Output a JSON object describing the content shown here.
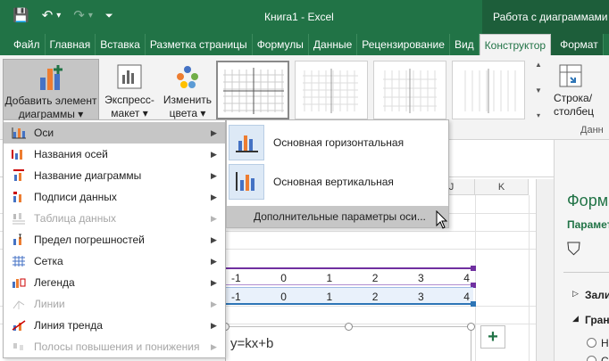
{
  "titlebar": {
    "save_icon": "💾",
    "undo_icon": "↶",
    "undo_caret": "▾",
    "redo_icon": "↷",
    "redo_caret": "▾",
    "qat_more": "⏷",
    "title": "Книга1 - Excel",
    "context": "Работа с диаграммами"
  },
  "tabs": [
    "Файл",
    "Главная",
    "Вставка",
    "Разметка страницы",
    "Формулы",
    "Данные",
    "Рецензирование",
    "Вид",
    "Конструктор",
    "Формат"
  ],
  "ribbon": {
    "add_element_line1": "Добавить элемент",
    "add_element_line2": "диаграммы ▾",
    "express_line1": "Экспресс-",
    "express_line2": "макет ▾",
    "color_line1": "Изменить",
    "color_line2": "цвета ▾",
    "switch_line1": "Строка/",
    "switch_line2": "столбец",
    "group_label": "Данн",
    "scroll_up": "▲",
    "scroll_down": "▼",
    "scroll_more": "▾"
  },
  "columns": [
    "J",
    "K"
  ],
  "rows": [
    [
      "-1",
      "0",
      "1",
      "2",
      "3",
      "4"
    ],
    [
      "-1",
      "0",
      "1",
      "2",
      "3",
      "4"
    ]
  ],
  "chart": {
    "title": "y=kx+b",
    "add_button": "+"
  },
  "pane": {
    "title": "Формат",
    "subtitle": "Парамет",
    "fill_icon": "⛉",
    "items": [
      "Заливка",
      "Граница"
    ],
    "item_arrows": [
      "▷",
      "◢"
    ],
    "radio_labels": [
      "Н",
      "С"
    ]
  },
  "menu": {
    "items": [
      {
        "label": "Оси",
        "icon": "axes-icon",
        "disabled": false,
        "arrow": "▶"
      },
      {
        "label": "Названия осей",
        "icon": "axis-titles-icon",
        "disabled": false,
        "arrow": "▶"
      },
      {
        "label": "Название диаграммы",
        "icon": "chart-title-icon",
        "disabled": false,
        "arrow": "▶"
      },
      {
        "label": "Подписи данных",
        "icon": "data-labels-icon",
        "disabled": false,
        "arrow": "▶"
      },
      {
        "label": "Таблица данных",
        "icon": "data-table-icon",
        "disabled": true,
        "arrow": "▶"
      },
      {
        "label": "Предел погрешностей",
        "icon": "error-bars-icon",
        "disabled": false,
        "arrow": "▶"
      },
      {
        "label": "Сетка",
        "icon": "gridlines-icon",
        "disabled": false,
        "arrow": "▶"
      },
      {
        "label": "Легенда",
        "icon": "legend-icon",
        "disabled": false,
        "arrow": "▶"
      },
      {
        "label": "Линии",
        "icon": "lines-icon",
        "disabled": true,
        "arrow": "▶"
      },
      {
        "label": "Линия тренда",
        "icon": "trendline-icon",
        "disabled": false,
        "arrow": "▶"
      },
      {
        "label": "Полосы повышения и понижения",
        "icon": "updown-bars-icon",
        "disabled": true,
        "arrow": "▶"
      }
    ]
  },
  "submenu": {
    "items": [
      "Основная горизонтальная",
      "Основная вертикальная"
    ],
    "more": "Дополнительные параметры оси..."
  },
  "colors": {
    "excel_green": "#217346",
    "highlight": "#c6c6c6"
  }
}
